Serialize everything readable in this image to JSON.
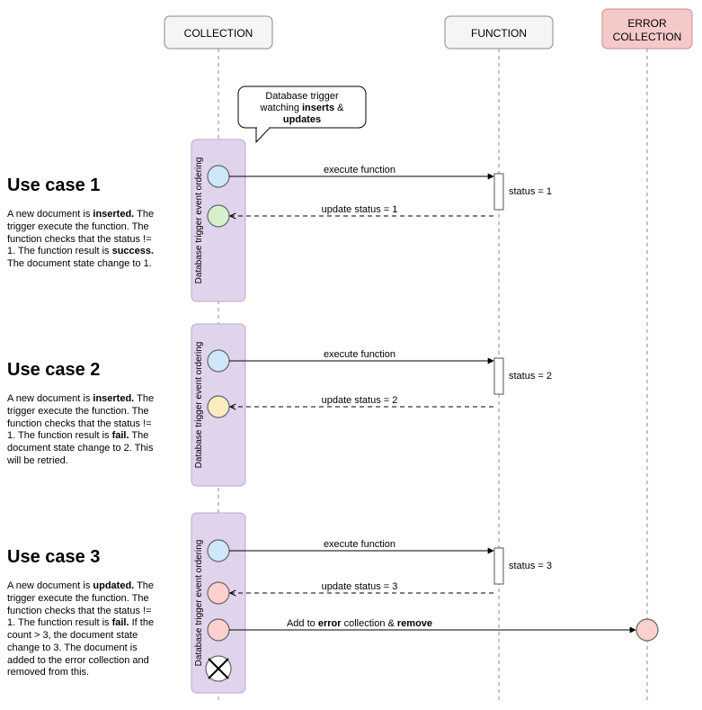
{
  "lanes": {
    "collection": "COLLECTION",
    "function": "FUNCTION",
    "error": "ERROR COLLECTION"
  },
  "callout": {
    "l1": "Database trigger",
    "l2_pre": "watching ",
    "l2_b1": "inserts",
    "l2_mid": " &",
    "l3_b": "updates"
  },
  "activationLabel": "Database trigger event ordering",
  "msgs": {
    "exec": "execute function",
    "upd1": "update status = 1",
    "upd2": "update status = 2",
    "upd3": "update status = 3",
    "addErr_pre": "Add to ",
    "addErr_b1": "error",
    "addErr_mid": " collection & ",
    "addErr_b2": "remove"
  },
  "statuses": {
    "s1": "status = 1",
    "s2": "status = 2",
    "s3": "status = 3"
  },
  "useCases": {
    "uc1": {
      "title": "Use case 1",
      "p1a": "A new document is ",
      "p1b": "inserted.",
      "p1c": " The trigger execute the function. The function checks that the status != 1. The function result is ",
      "p1d": "success.",
      "p1e": " The document state change to 1."
    },
    "uc2": {
      "title": "Use case 2",
      "p1a": "A new document is ",
      "p1b": "inserted.",
      "p1c": " The trigger execute the function. The function checks that the status != 1. The function result is ",
      "p1d": "fail.",
      "p1e": " The document state change to 2. This will be retried."
    },
    "uc3": {
      "title": "Use case 3",
      "p1a": "A new document is ",
      "p1b": "updated.",
      "p1c": " The trigger execute the function. The function checks that the status != 1. The function result is ",
      "p1d": "fail.",
      "p1e": " If the count > 3, the document state change to 3. The document is added to the error collection and removed from this."
    }
  }
}
